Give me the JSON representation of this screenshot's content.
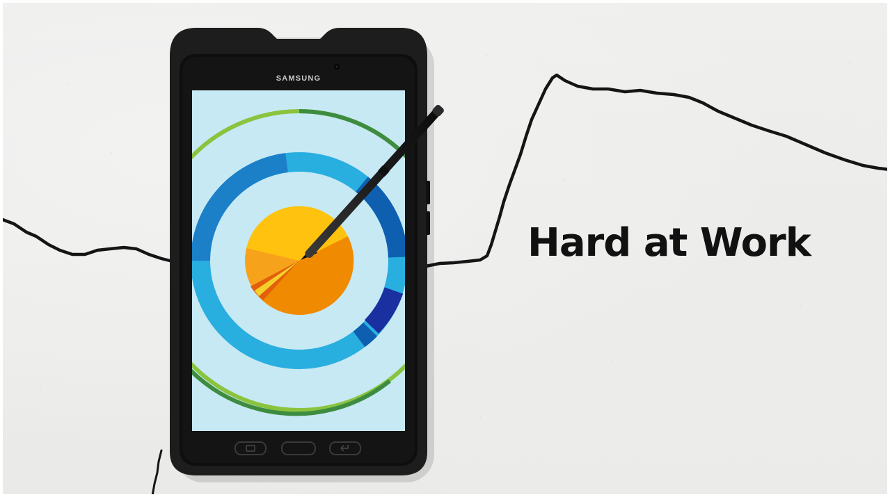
{
  "headline": {
    "text": "Hard at Work",
    "color": "#111111"
  },
  "device": {
    "brand_label": "SAMSUNG",
    "body_color": "#1f1f1f",
    "screen_background": "#c7e9f4"
  },
  "background": {
    "wall_color": "#ececea",
    "crack_color": "#151515"
  },
  "illustration": {
    "outer_ring_colors": [
      "#8ac43f",
      "#3d8c40"
    ],
    "middle_ring_colors": [
      "#29aee0",
      "#1b80c8",
      "#0f5fb0",
      "#1a2fa0"
    ],
    "pie_colors": [
      "#ffc20e",
      "#f7a21b",
      "#f08a00",
      "#e35f0c",
      "#f5d02b"
    ]
  }
}
